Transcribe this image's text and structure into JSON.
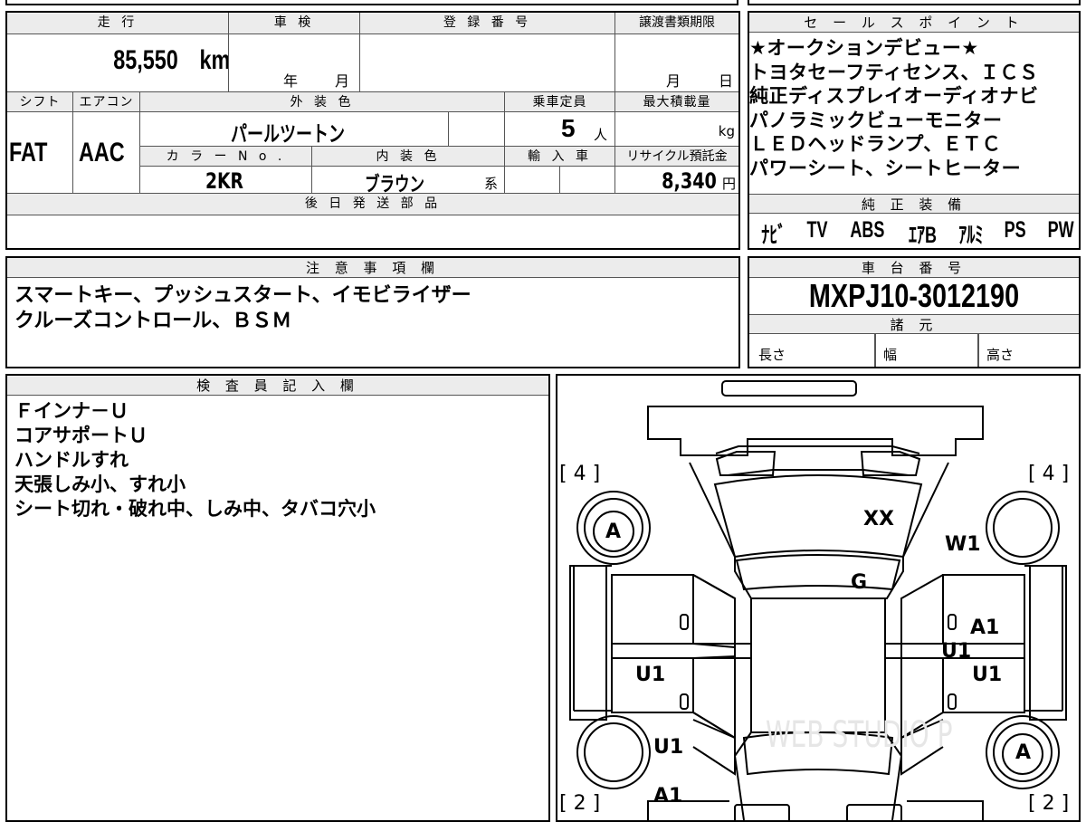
{
  "top_panel": {
    "headers": {
      "mileage": "走 行",
      "inspection": "車 検",
      "registration": "登 録 番 号",
      "transfer_deadline": "譲渡書類期限",
      "shift": "シフト",
      "aircon": "エアコン",
      "exterior_color": "外 装 色",
      "capacity": "乗車定員",
      "max_load": "最大積載量",
      "color_no": "カ ラ ー N o .",
      "interior_color": "内 装 色",
      "import": "輸 入 車",
      "recycle": "リサイクル預託金",
      "later_parts": "後 日 発 送 部 品"
    },
    "values": {
      "mileage": "85,550",
      "mileage_unit": "km",
      "inspection_year": "年",
      "inspection_month": "月",
      "transfer_month": "月",
      "transfer_day": "日",
      "shift": "FAT",
      "aircon": "AAC",
      "exterior_color": "パールツートン",
      "capacity": "5",
      "capacity_unit": "人",
      "max_load_unit": "kg",
      "color_no": "2KR",
      "interior_color": "ブラウン",
      "interior_suffix": "系",
      "recycle": "8,340",
      "recycle_unit": "円"
    }
  },
  "sales_points": {
    "header": "セ ー ル ス ポ イ ン ト",
    "lines": [
      "★オークションデビュー★",
      "トヨタセーフティセンス、ＩＣＳ",
      "純正ディスプレイオーディオナビ",
      "パノラミックビューモニター",
      "ＬＥＤヘッドランプ、ＥＴＣ",
      "パワーシート、シートヒーター"
    ]
  },
  "equipment": {
    "header": "純 正 装 備",
    "items": [
      "ﾅﾋﾞ",
      "TV",
      "ABS",
      "ｴｱB",
      "ｱﾙﾐ",
      "PS",
      "PW"
    ]
  },
  "notes": {
    "header": "注 意 事 項 欄",
    "lines": [
      "スマートキー、プッシュスタート、イモビライザー",
      "クルーズコントロール、ＢＳＭ"
    ]
  },
  "chassis": {
    "header": "車 台 番 号",
    "number": "MXPJ10-3012190",
    "spec_header": "諸 元",
    "length": "長さ",
    "width": "幅",
    "height": "高さ"
  },
  "inspector": {
    "header": "検 査 員 記 入 欄",
    "lines": [
      "Ｆインナ－Ｕ",
      "コアサポートＵ",
      "ハンドルすれ",
      "天張しみ小、すれ小",
      "シート切れ・破れ中、しみ中、タバコ穴小"
    ]
  },
  "diagram": {
    "tire_front_left": "[ 4 ]",
    "tire_front_right": "[ 4 ]",
    "tire_rear_left": "[ 2 ]",
    "tire_rear_right": "[ 2 ]",
    "wheel_fl": "A",
    "wheel_rr": "A",
    "marks": {
      "windshield": "XX",
      "front_right_fender": "W1",
      "roof_front": "G",
      "right_front_door": "A1",
      "right_center": "U1",
      "right_rear_door": "U1",
      "left_rear_door": "U1",
      "left_rear_fender": "U1",
      "left_rear_quarter": "A1"
    },
    "watermark": "WEB STUDIO P"
  }
}
